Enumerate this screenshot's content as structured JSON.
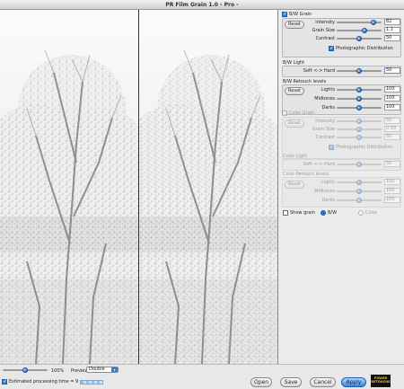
{
  "window": {
    "title": "PR Film Grain 1.0 - Pro -"
  },
  "colors": {
    "accent": "#2f7fd6",
    "panel": "#ececec",
    "preview_bg": "#fafafa"
  },
  "bw_grain": {
    "enabled_label": "B/W Grain",
    "enabled": true,
    "reset_label": "Reset",
    "intensity": {
      "label": "Intensity",
      "value": "82",
      "level": 0.82
    },
    "grain_size": {
      "label": "Grain Size",
      "value": "1.1",
      "level": 0.62
    },
    "contrast": {
      "label": "Contrast",
      "value": "50",
      "level": 0.5
    },
    "photographic_label": "Photographic Distribution",
    "photographic": true
  },
  "bw_light": {
    "heading": "B/W Light",
    "soft_hard": {
      "label": "Soft <-> Hard",
      "value": "50",
      "level": 0.5
    }
  },
  "bw_retouch": {
    "heading": "B/W Retouch levels",
    "reset_label": "Reset",
    "lights": {
      "label": "Lights",
      "value": "100",
      "level": 0.5
    },
    "midtones": {
      "label": "Midtones",
      "value": "100",
      "level": 0.5
    },
    "darks": {
      "label": "Darks",
      "value": "100",
      "level": 0.5
    }
  },
  "color_grain": {
    "enabled_label": "Color Grain",
    "enabled": false,
    "reset_label": "Reset",
    "intensity": {
      "label": "Intensity",
      "value": "50",
      "level": 0.5
    },
    "grain_size": {
      "label": "Grain Size",
      "value": "0.50",
      "level": 0.5
    },
    "contrast": {
      "label": "Contrast",
      "value": "50",
      "level": 0.5
    },
    "photographic_label": "Photographic Distribution",
    "photographic": true
  },
  "color_light": {
    "heading": "Color Light",
    "soft_hard": {
      "label": "Soft <-> Hard",
      "value": "50",
      "level": 0.5
    }
  },
  "color_retouch": {
    "heading": "Color Retouch levels",
    "reset_label": "Reset",
    "lights": {
      "label": "Lights",
      "value": "100",
      "level": 0.5
    },
    "midtones": {
      "label": "Midtones",
      "value": "100",
      "level": 0.5
    },
    "darks": {
      "label": "Darks",
      "value": "100",
      "level": 0.5
    }
  },
  "show_grain": {
    "label": "Show grain",
    "checked": false,
    "bw_label": "B/W",
    "color_label": "Color",
    "selected": "B/W"
  },
  "bottom": {
    "zoom_value": "100%",
    "zoom_level": 0.5,
    "preview_label": "Preview",
    "preview_option": "Double",
    "estimate_label": "Estimated processing time = 9 sec.",
    "estimate_checked": true,
    "open_label": "Open",
    "save_label": "Save",
    "cancel_label": "Cancel",
    "apply_label": "Apply",
    "logo_line1": "POWER",
    "logo_line2": "RETOUCHE"
  }
}
